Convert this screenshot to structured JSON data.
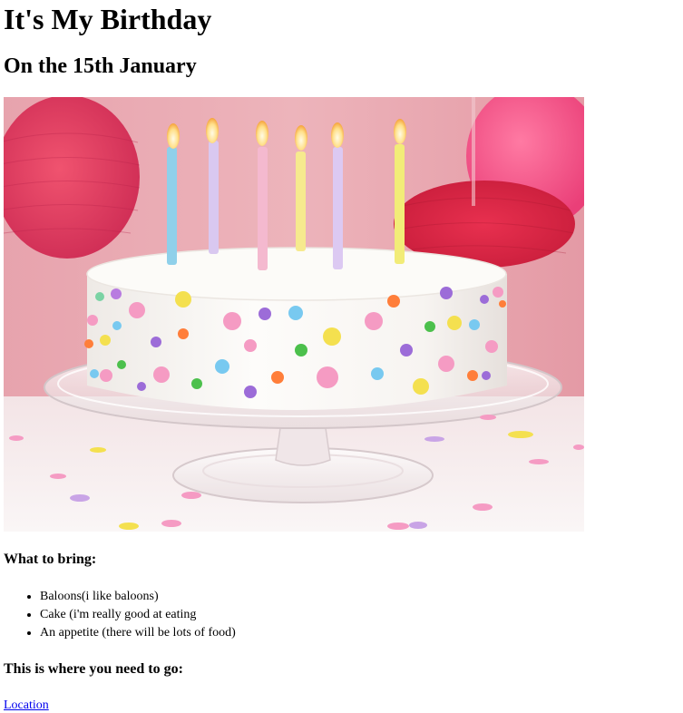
{
  "page": {
    "title": "It's My Birthday",
    "subtitle": "On the 15th January"
  },
  "hero_image": {
    "icon": "birthday-cake-photo",
    "colors": {
      "wall": "#e9a9b1",
      "table": "#f6f0f1",
      "frosting": "#fbf9f7",
      "lantern": "#e0375f"
    }
  },
  "bring": {
    "heading": "What to bring:",
    "items": [
      "Baloons(i like baloons)",
      "Cake (i'm really good at eating",
      "An appetite (there will be lots of food)"
    ]
  },
  "directions": {
    "heading": "This is where you need to go:",
    "link_label": "Location"
  },
  "colors": {
    "link": "#0000ee",
    "text": "#000000",
    "background": "#ffffff"
  }
}
